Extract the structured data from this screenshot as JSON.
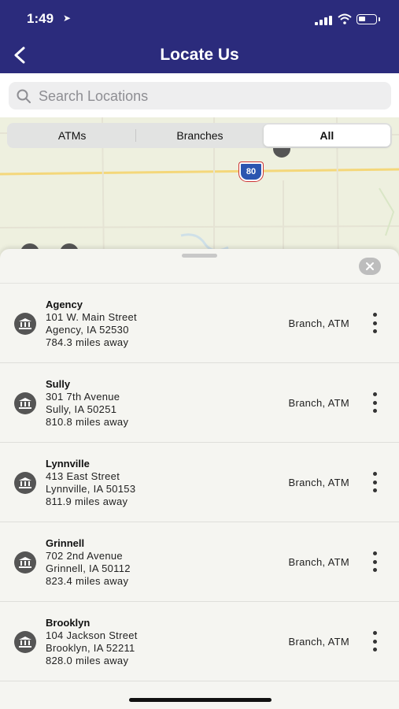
{
  "status_bar": {
    "time": "1:49"
  },
  "header": {
    "title": "Locate Us"
  },
  "search": {
    "placeholder": "Search Locations"
  },
  "map": {
    "highway_shield": "80"
  },
  "segments": [
    {
      "label": "ATMs",
      "active": false
    },
    {
      "label": "Branches",
      "active": false
    },
    {
      "label": "All",
      "active": true
    }
  ],
  "locations": [
    {
      "name": "Agency",
      "address": "101 W. Main Street",
      "city": "Agency, IA 52530",
      "distance": "784.3 miles away",
      "type": "Branch, ATM"
    },
    {
      "name": "Sully",
      "address": "301 7th Avenue",
      "city": "Sully, IA 50251",
      "distance": "810.8 miles away",
      "type": "Branch, ATM"
    },
    {
      "name": "Lynnville",
      "address": "413 East Street",
      "city": "Lynnville, IA 50153",
      "distance": "811.9 miles away",
      "type": "Branch, ATM"
    },
    {
      "name": "Grinnell",
      "address": "702 2nd Avenue",
      "city": "Grinnell, IA 50112",
      "distance": "823.4 miles away",
      "type": "Branch, ATM"
    },
    {
      "name": "Brooklyn",
      "address": "104 Jackson Street",
      "city": "Brooklyn, IA 52211",
      "distance": "828.0 miles away",
      "type": "Branch, ATM"
    }
  ],
  "colors": {
    "header_bg": "#2b2b7c",
    "sheet_bg": "#f5f5f1",
    "map_bg": "#eef0df"
  }
}
